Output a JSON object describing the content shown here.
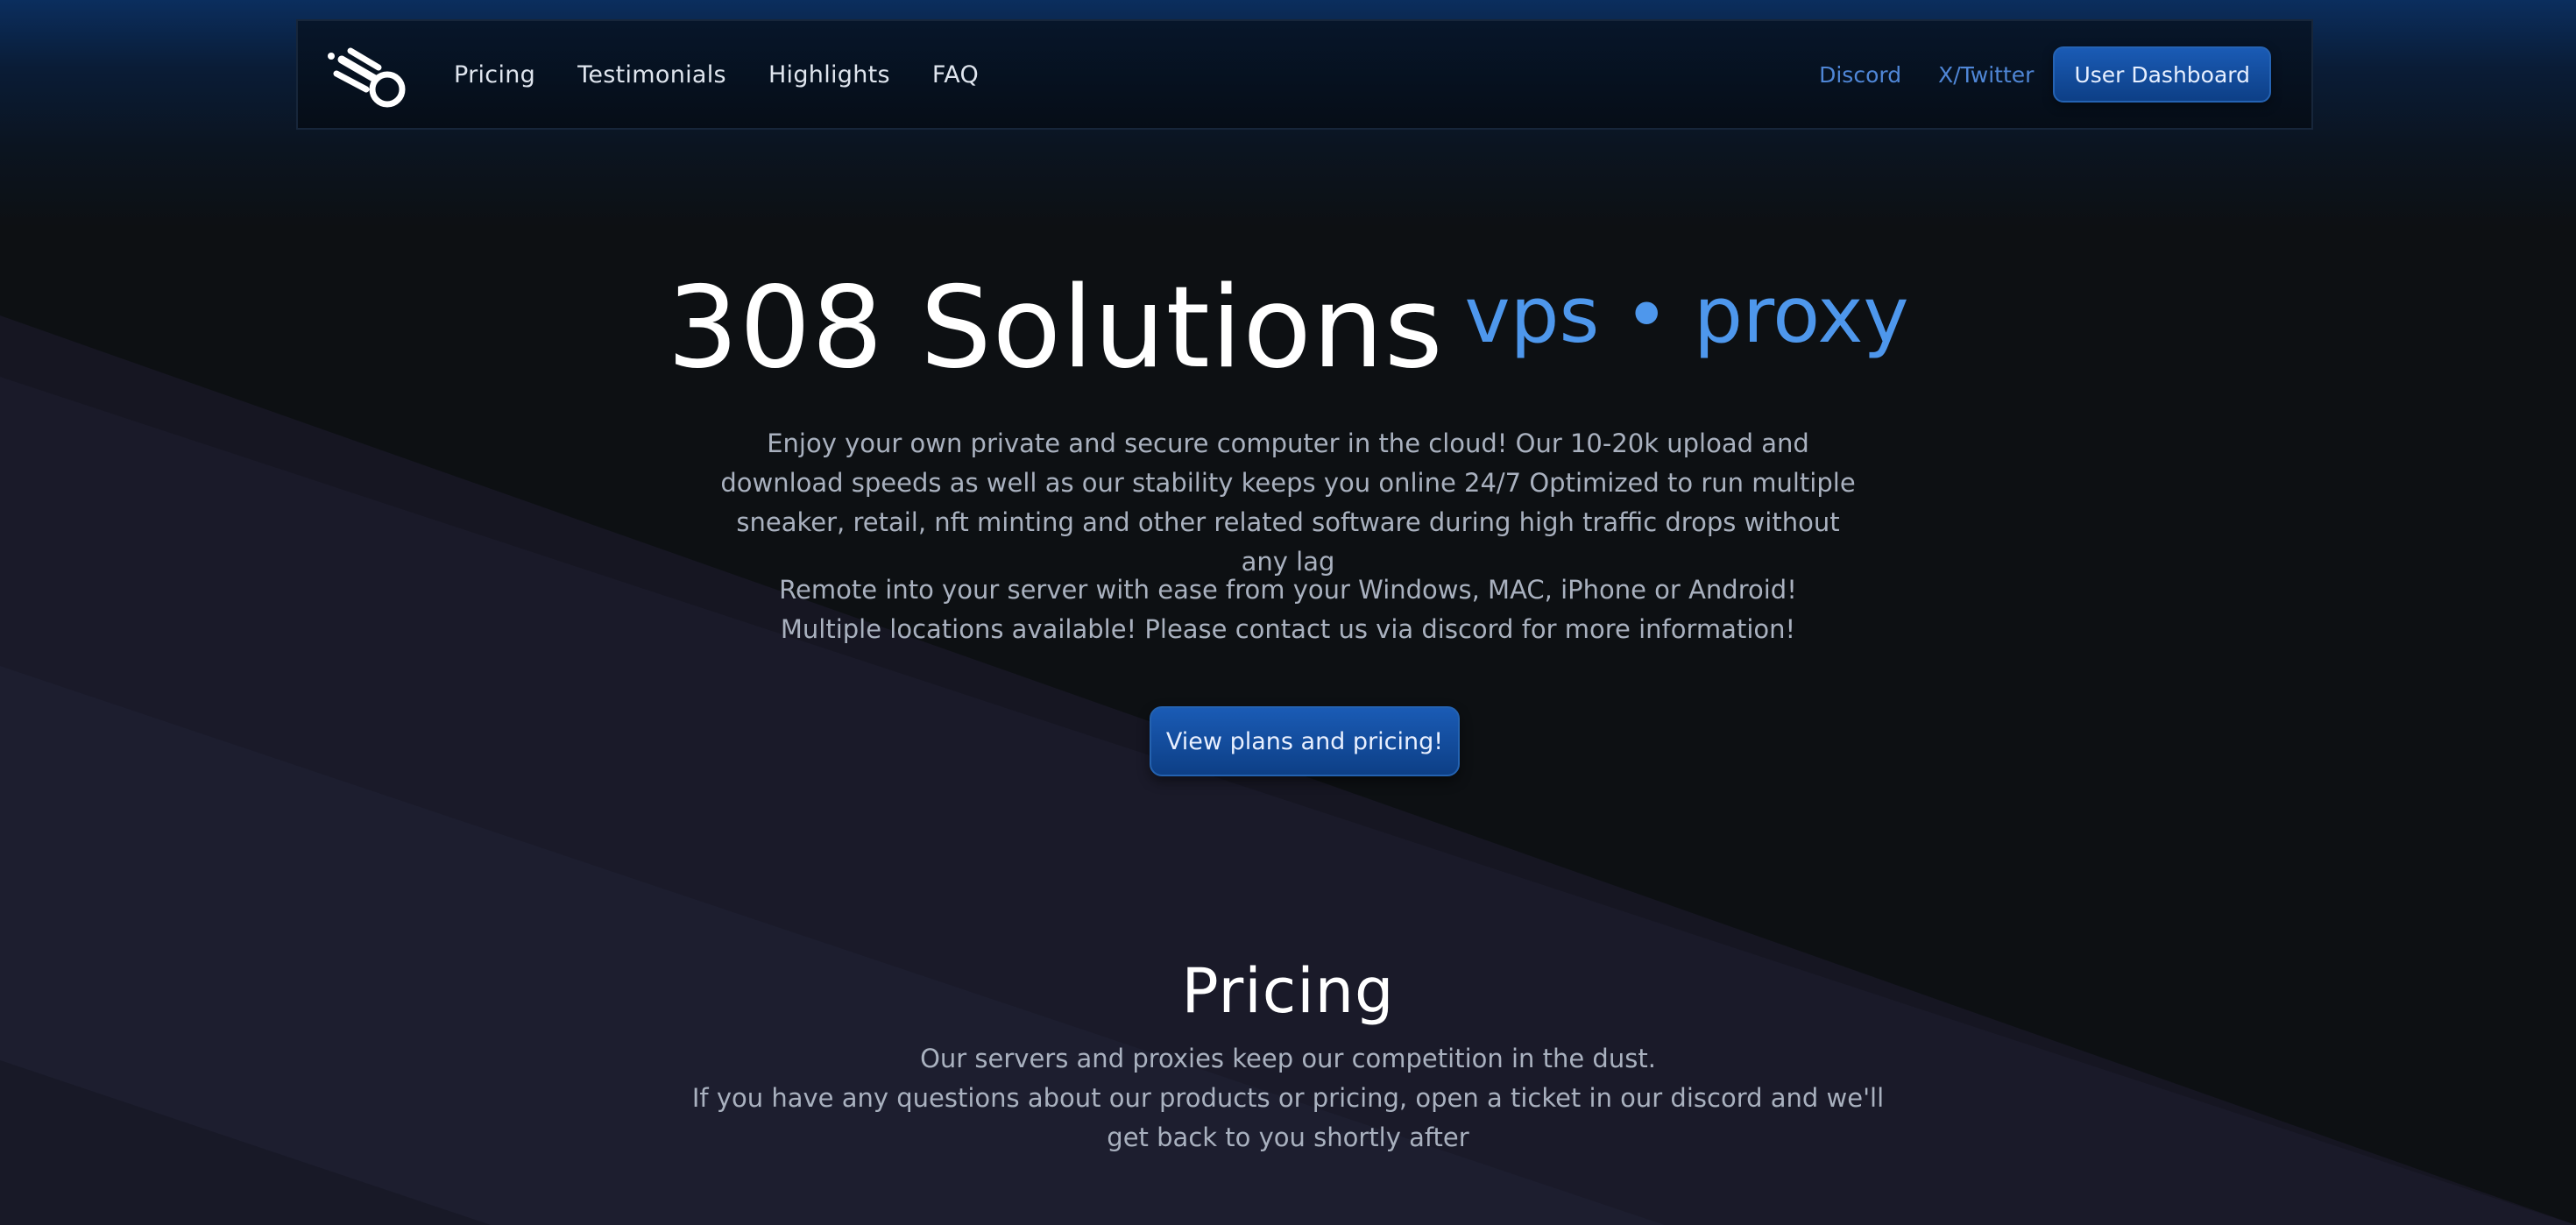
{
  "colors": {
    "background": "#0d1013",
    "stripe": "#1c1d2d",
    "accent": "#4e97ec",
    "button": "#1550a0",
    "muted_text": "#a9b1bf"
  },
  "nav": {
    "logo_icon": "comet-logo-icon",
    "links": [
      "Pricing",
      "Testimonials",
      "Highlights",
      "FAQ"
    ],
    "discord": "Discord",
    "twitter": "X/Twitter",
    "dashboard_button": "User Dashboard"
  },
  "hero": {
    "title": "308 Solutions",
    "subtitle": "vps • proxy",
    "paragraph1": "Enjoy your own private and secure computer in the cloud! Our 10-20k upload and download speeds as well as our stability keeps you online 24/7 Optimized to run multiple sneaker, retail, nft minting and other related software during high traffic drops without any lag",
    "paragraph2": "Remote into your server with ease from your Windows, MAC, iPhone or Android! Multiple locations available! Please contact us via discord for more information!",
    "cta_button": "View plans and pricing!"
  },
  "pricing": {
    "heading": "Pricing",
    "line1": "Our servers and proxies keep our competition in the dust.",
    "line2": "If you have any questions about our products or pricing, open a ticket in our discord and we'll get back to you shortly after"
  }
}
